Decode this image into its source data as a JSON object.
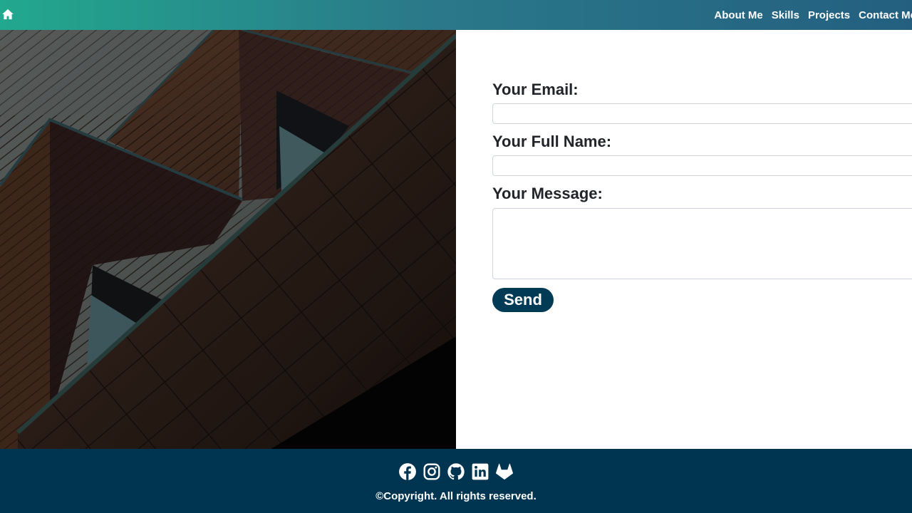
{
  "nav": {
    "home_icon": "home-icon",
    "links": [
      {
        "label": "About Me"
      },
      {
        "label": "Skills"
      },
      {
        "label": "Projects"
      },
      {
        "label": "Contact Me"
      }
    ]
  },
  "form": {
    "email_label": "Your Email:",
    "email_value": "",
    "name_label": "Your Full Name:",
    "name_value": "",
    "message_label": "Your Message:",
    "message_value": "",
    "send_label": "Send"
  },
  "footer": {
    "social_icons": [
      "facebook-icon",
      "instagram-icon",
      "github-icon",
      "linkedin-icon",
      "gitlab-icon"
    ],
    "copyright": "©Copyright. All rights reserved."
  },
  "colors": {
    "nav_gradient_start": "#22a88e",
    "nav_gradient_end": "#245f80",
    "send_button": "#003a55",
    "footer": "#003552"
  }
}
